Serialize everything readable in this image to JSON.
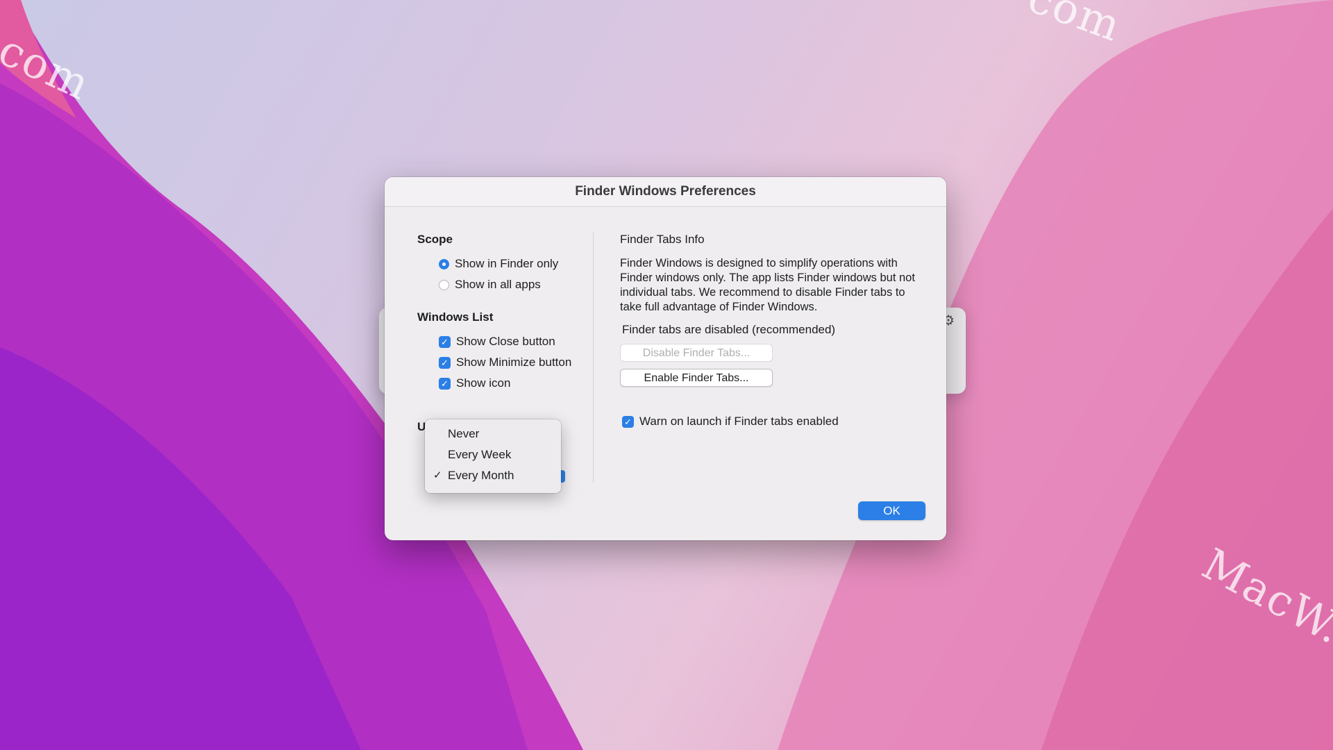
{
  "window": {
    "title": "Finder Windows Preferences"
  },
  "scope": {
    "title": "Scope",
    "options": [
      {
        "label": "Show in Finder only",
        "selected": true
      },
      {
        "label": "Show in all apps",
        "selected": false
      }
    ]
  },
  "windows_list": {
    "title": "Windows List",
    "options": [
      {
        "label": "Show Close button",
        "checked": true
      },
      {
        "label": "Show Minimize button",
        "checked": true
      },
      {
        "label": "Show icon",
        "checked": true
      }
    ]
  },
  "update": {
    "title_partial": "U"
  },
  "frequency_menu": {
    "items": [
      {
        "label": "Never",
        "checked": false
      },
      {
        "label": "Every Week",
        "checked": false
      },
      {
        "label": "Every Month",
        "checked": true
      }
    ],
    "tick": "✓"
  },
  "finder_tabs": {
    "title": "Finder Tabs Info",
    "body": "Finder Windows is designed to simplify operations with Finder windows only. The app lists Finder windows but not individual tabs. We recommend to disable Finder tabs to take full advantage of Finder Windows.",
    "status": "Finder tabs are disabled (recommended)",
    "disable_button": "Disable Finder Tabs...",
    "enable_button": "Enable Finder Tabs...",
    "warn_label": "Warn on launch if Finder tabs enabled",
    "warn_checked": true
  },
  "ok_button": "OK",
  "watermarks": [
    "com",
    "com",
    "MacW.co",
    "MacW.com"
  ],
  "check_glyph": "✓",
  "gear_glyph": "⚙",
  "accent_color": "#2b7fe6"
}
